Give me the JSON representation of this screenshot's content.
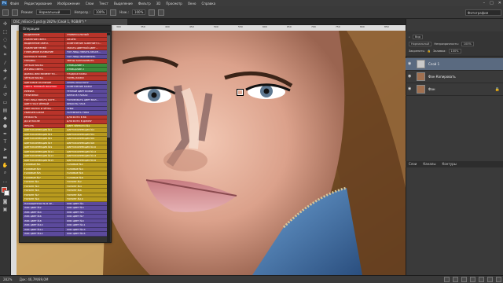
{
  "menu": {
    "logo": "Ps",
    "items": [
      "Файл",
      "Редактирование",
      "Изображение",
      "Слои",
      "Текст",
      "Выделение",
      "Фильтр",
      "3D",
      "Просмотр",
      "Окно",
      "Справка"
    ]
  },
  "options": {
    "mode_label": "Режим:",
    "mode_value": "Нормальный",
    "opacity_label": "Непрозр.:",
    "opacity_value": "100%",
    "flow_label": "Наж.:",
    "flow_value": "100%",
    "workspace": "Фотография"
  },
  "document": {
    "tab": "DSC_mExcv-1.psd @ 282% (Слой 1, RGB/8*) *"
  },
  "status": {
    "zoom": "282%",
    "doc": "Док: 46,7M/89,0M"
  },
  "ruler": [
    "100",
    "150",
    "200",
    "250",
    "300",
    "350",
    "400",
    "450",
    "500",
    "550",
    "600",
    "650",
    "700",
    "750",
    "800",
    "850"
  ],
  "actions": {
    "title": "Операции",
    "rows": [
      {
        "l": "ВЫДЕЛЕНИЕ",
        "r": "УНИВЕРСАЛЬНЫЙ",
        "lc": "#b8342a",
        "rc": "#b8342a"
      },
      {
        "l": "УСИЛЕНИЕ СВЕТА",
        "r": "ОБЪЁМ",
        "lc": "#b8342a",
        "rc": "#b8342a"
      },
      {
        "l": "ВЫДЕЛЕНИЕ СВЕТА",
        "r": "ОСВЕТЛЕНИЕ ЗАМЕНЯЕТ С...",
        "lc": "#b8342a",
        "rc": "#b8342a"
      },
      {
        "l": "УСИЛЕНИЕ ТЕНЕЙ",
        "r": "УБРАТЬ ЦВЕТНОЙ ЦВЕТ...",
        "lc": "#b8342a",
        "rc": "#b8342a"
      },
      {
        "l": "ГЛЯНЦЕВОЕ РАЗМЫТИЕ",
        "r": "ТОН ЛИЦА УБРАТЬ КРАСН...",
        "lc": "#b8342a",
        "rc": "#5c4a9c"
      },
      {
        "l": "КОНТРАСТ ТОНОВ",
        "r": "ТОН ЛИЦА ВЫРОВНЯТЬ",
        "lc": "#b8342a",
        "rc": "#5c4a9c"
      },
      {
        "l": "УПРАВКА",
        "r": "ЗВЕЗД ЗАКРАШИВАТЬ",
        "lc": "#b8342a",
        "rc": "#b8342a"
      },
      {
        "l": "ЧЁТКАЯ МАСКА",
        "r": "ОТРИЦАНИЕ 1",
        "lc": "#b8342a",
        "rc": "#3b8a3a"
      },
      {
        "l": "ИЗГИБЫ СВЕТА",
        "r": "ОТРИЦАНИЕ 2",
        "lc": "#b8342a",
        "rc": "#3b8a3a"
      },
      {
        "l": "ДЫМКА ИЛИ ЭФФЕКТ ТО...",
        "r": "ГЛАДКАЯ КОЖА",
        "lc": "#b8342a",
        "rc": "#b8342a"
      },
      {
        "l": "ЧЁТКАЯ МАСКА",
        "r": "ТОНЕЦ КОЖИ",
        "lc": "#b8342a",
        "rc": "#b8342a"
      },
      {
        "l": "ЦВЕТОВОЕ РАЗЛИЧИЕ",
        "r": "СНЯТЬ КРАСНОТУ",
        "lc": "#b8342a",
        "rc": "#5c4a9c"
      },
      {
        "l": "СВЕТО ТЕНЕВОЙ РИСУНОК",
        "r": "ОСВЕТЛЕНИЕ КОЖИ",
        "lc": "#e01e24",
        "rc": "#5c4a9c"
      },
      {
        "l": "РУМЯНА",
        "r": "ТЕПЛЫЙ ЦВЕТ КОЖИ",
        "lc": "#b8342a",
        "rc": "#5c4a9c"
      },
      {
        "l": "ТЕНИ ВЕКИ",
        "r": "БЛЕСК В ГЛАЗАХ",
        "lc": "#b8342a",
        "rc": "#5c4a9c"
      },
      {
        "l": "ТОН ЛИЦА УБРАТЬ КОНТ...",
        "r": "ТОНИРОВАТЬ ЦВЕТ ВОЛ...",
        "lc": "#b8342a",
        "rc": "#5c4a9c"
      },
      {
        "l": "ЦВЕТ ГЛАЗ ЧЁРНЫЙ",
        "r": "ЯРКОСТЬ ГЛАЗ",
        "lc": "#b8342a",
        "rc": "#5c4a9c"
      },
      {
        "l": "СВЕТ ВОЛОС И ЧЁТКА...",
        "r": "ЗУБЫ",
        "lc": "#b8342a",
        "rc": "#5c4a9c"
      },
      {
        "l": "УБИРАЕМ ШРАМ",
        "r": "ЗАТЕМНИТЬ ГУБЫ",
        "lc": "#b8342a",
        "rc": "#5c4a9c"
      },
      {
        "l": "РЕЗКОСТЬ",
        "r": "ДЛЯ ФОТО В ВК",
        "lc": "#b8342a",
        "rc": "#b8342a"
      },
      {
        "l": "ДО И ПОСЛЕ",
        "r": "ДЛЯ ФОТО В ДЛИНУ",
        "lc": "#b8342a",
        "rc": "#b8342a"
      },
      {
        "l": "ПЕЧАТЬ",
        "r": "ЦВЕТ ЧЁРНОГО №1",
        "lc": "#b8342a",
        "rc": "#b89a1e"
      },
      {
        "l": "ЦВЕТОКОРРЕКЦИЯ №1",
        "r": "ЦВЕТОКОРРЕКЦИЯ №2",
        "lc": "#b89a1e",
        "rc": "#b89a1e"
      },
      {
        "l": "ЦВЕТОКОРРЕКЦИЯ №3",
        "r": "ЦВЕТОКОРРЕКЦИЯ №4",
        "lc": "#b89a1e",
        "rc": "#b89a1e"
      },
      {
        "l": "ЦВЕТОКОРРЕКЦИЯ №5",
        "r": "ЦВЕТОКОРРЕКЦИЯ №6",
        "lc": "#b89a1e",
        "rc": "#b89a1e"
      },
      {
        "l": "ЦВЕТОКОРРЕКЦИЯ №7",
        "r": "ЦВЕТОКОРРЕКЦИЯ №8",
        "lc": "#b89a1e",
        "rc": "#b89a1e"
      },
      {
        "l": "ЦВЕТОКОРРЕКЦИЯ №9",
        "r": "ЦВЕТОКОРРЕКЦИЯ №10",
        "lc": "#b89a1e",
        "rc": "#b89a1e"
      },
      {
        "l": "ЦВЕТОКОРРЕКЦИЯ №11",
        "r": "ЦВЕТОКОРРЕКЦИЯ №12",
        "lc": "#b89a1e",
        "rc": "#b89a1e"
      },
      {
        "l": "ЦВЕТОКОРРЕКЦИЯ №13",
        "r": "ЦВЕТОКОРРЕКЦИЯ №14",
        "lc": "#b89a1e",
        "rc": "#b89a1e"
      },
      {
        "l": "ЦВЕТОКОРРЕКЦИЯ №15",
        "r": "ЦВЕТОКОРРЕКЦИЯ №16",
        "lc": "#b89a1e",
        "rc": "#b89a1e"
      },
      {
        "l": "ГАЗОВЫЕ №1",
        "r": "ГАЗОВЫЕ №2",
        "lc": "#b89a1e",
        "rc": "#b89a1e"
      },
      {
        "l": "ГАЗОВЫЕ №3",
        "r": "ГАЗОВЫЕ №4",
        "lc": "#b89a1e",
        "rc": "#b89a1e"
      },
      {
        "l": "ГАЗОВЫЕ №5",
        "r": "ГАЗОВЫЕ №6",
        "lc": "#b89a1e",
        "rc": "#b89a1e"
      },
      {
        "l": "ГАЗОВЫЕ №7",
        "r": "ГАЗОВЫЕ №8",
        "lc": "#b89a1e",
        "rc": "#b89a1e"
      },
      {
        "l": "ТОНИНГ №1",
        "r": "ТОНИНГ №2",
        "lc": "#b89a1e",
        "rc": "#b89a1e"
      },
      {
        "l": "ТОНИНГ №3",
        "r": "ТОНИНГ №4",
        "lc": "#b89a1e",
        "rc": "#b89a1e"
      },
      {
        "l": "ТОНИНГ №5",
        "r": "ТОНИНГ №6",
        "lc": "#b89a1e",
        "rc": "#b89a1e"
      },
      {
        "l": "ТОНИНГ №7",
        "r": "ТОНИНГ №8",
        "lc": "#b89a1e",
        "rc": "#b89a1e"
      },
      {
        "l": "ТОНИНГ №9",
        "r": "ТОНИНГ №10",
        "lc": "#b89a1e",
        "rc": "#b89a1e"
      },
      {
        "l": "НАСЫЩЕННОСТЬ В ЧЕ...",
        "r": "ЛИК ЦВЕТ №1",
        "lc": "#5c4a9c",
        "rc": "#5c4a9c"
      },
      {
        "l": "ЛИК ЦВЕТ №2",
        "r": "ЛИК ЦВЕТ №3",
        "lc": "#5c4a9c",
        "rc": "#5c4a9c"
      },
      {
        "l": "ЛИК ЦВЕТ №4",
        "r": "ЛИК ЦВЕТ №5",
        "lc": "#5c4a9c",
        "rc": "#5c4a9c"
      },
      {
        "l": "ЛИК ЦВЕТ №6",
        "r": "ЛИК ЦВЕТ №7",
        "lc": "#5c4a9c",
        "rc": "#5c4a9c"
      },
      {
        "l": "ЛИК ЦВЕТ №8",
        "r": "ЛИК ЦВЕТ №9",
        "lc": "#5c4a9c",
        "rc": "#5c4a9c"
      },
      {
        "l": "ЛИК ЦВЕТ №10",
        "r": "ЛИК ЦВЕТ №11",
        "lc": "#5c4a9c",
        "rc": "#5c4a9c"
      },
      {
        "l": "ЛИК ЦВЕТ №12",
        "r": "ЛИК ЦВЕТ №13",
        "lc": "#5c4a9c",
        "rc": "#5c4a9c"
      },
      {
        "l": "ЛИК ЦВЕТ №14",
        "r": "ЛИК ЦВЕТ №15",
        "lc": "#5c4a9c",
        "rc": "#5c4a9c"
      }
    ]
  },
  "layers_panel": {
    "filter": "Вид",
    "blend": "Нормальный",
    "opacity_label": "Непрозрачность:",
    "opacity": "100%",
    "lock_label": "Закрепить:",
    "fill_label": "Заливка:",
    "fill": "100%",
    "layers": [
      {
        "name": "Слой 1",
        "selected": true
      },
      {
        "name": "Фон Копировать",
        "selected": false
      },
      {
        "name": "Фон",
        "selected": false
      }
    ]
  },
  "bottom_tabs": [
    "Слои",
    "Каналы",
    "Контуры"
  ],
  "colors": {
    "accent": "#5a6a80",
    "fg": "#d23a2a",
    "bg": "#f4f4f4"
  }
}
